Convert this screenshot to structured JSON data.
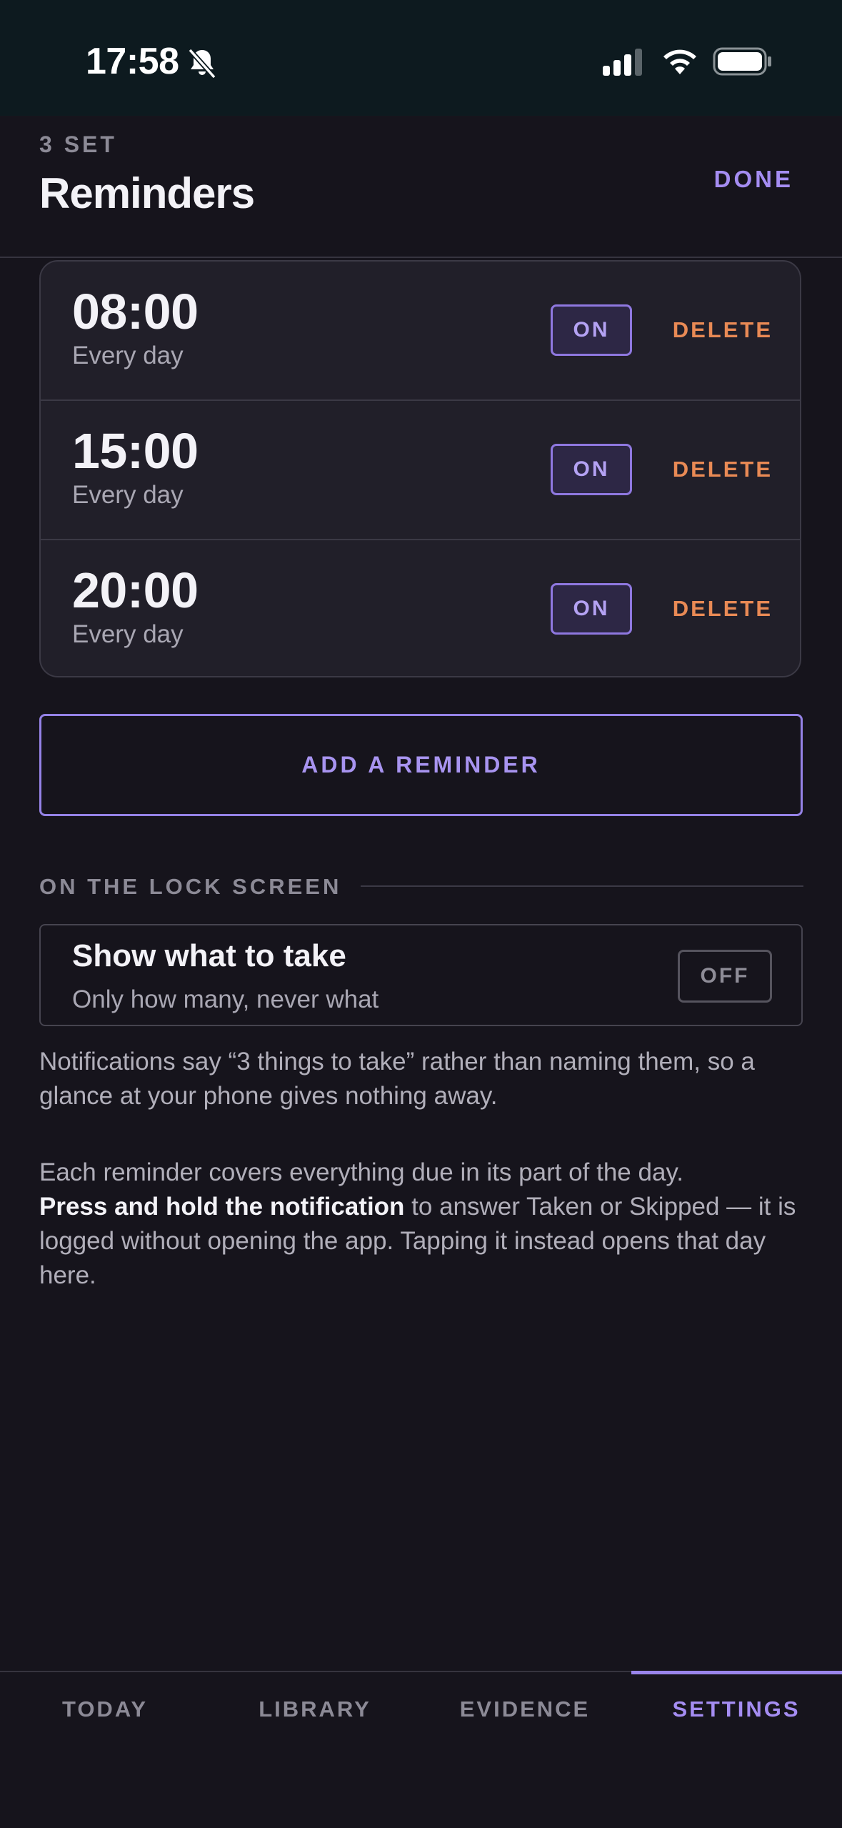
{
  "status_bar": {
    "time": "17:58"
  },
  "header": {
    "count_label": "3 SET",
    "title": "Reminders",
    "done_label": "DONE"
  },
  "reminders": [
    {
      "time": "08:00",
      "repeat": "Every day",
      "toggle": "ON",
      "delete_label": "DELETE"
    },
    {
      "time": "15:00",
      "repeat": "Every day",
      "toggle": "ON",
      "delete_label": "DELETE"
    },
    {
      "time": "20:00",
      "repeat": "Every day",
      "toggle": "ON",
      "delete_label": "DELETE"
    }
  ],
  "add_button": "ADD A REMINDER",
  "lock_screen": {
    "section_title": "ON THE LOCK SCREEN",
    "setting_title": "Show what to take",
    "setting_subtitle": "Only how many, never what",
    "toggle": "OFF",
    "explanation": "Notifications say “3 things to take” rather than naming them, so a glance at your phone gives nothing away."
  },
  "info": {
    "intro": "Each reminder covers everything due in its part of the day.",
    "emphasis": "Press and hold the notification",
    "rest": " to answer Taken or Skipped — it is logged without opening the app. Tapping it instead opens that day here."
  },
  "tabs": [
    {
      "label": "TODAY"
    },
    {
      "label": "LIBRARY"
    },
    {
      "label": "EVIDENCE"
    },
    {
      "label": "SETTINGS",
      "active": true
    }
  ],
  "colors": {
    "background": "#16141c",
    "accent": "#a58df2",
    "danger": "#e98a55",
    "status_bar": "#0d1a1f"
  }
}
